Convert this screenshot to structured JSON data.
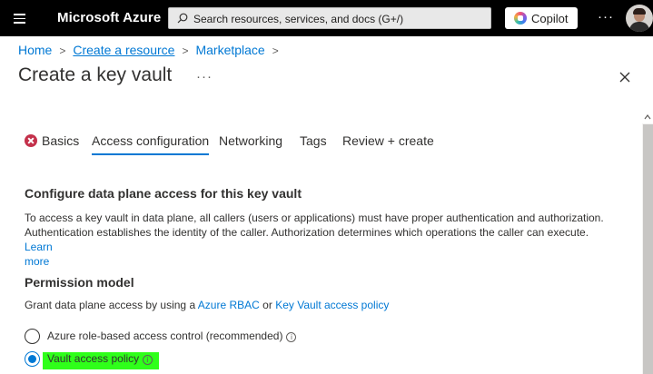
{
  "topbar": {
    "brand": "Microsoft Azure",
    "search_placeholder": "Search resources, services, and docs (G+/)",
    "copilot_label": "Copilot",
    "more": "···",
    "accent": "#000000"
  },
  "breadcrumb": {
    "items": [
      "Home",
      "Create a resource",
      "Marketplace"
    ],
    "separator": ">"
  },
  "page": {
    "title": "Create a key vault",
    "ellipsis": "···",
    "close_icon": "close-icon"
  },
  "tabs": [
    {
      "label": "Basics",
      "state": "error"
    },
    {
      "label": "Access configuration",
      "state": "active"
    },
    {
      "label": "Networking",
      "state": "normal"
    },
    {
      "label": "Tags",
      "state": "normal"
    },
    {
      "label": "Review + create",
      "state": "normal"
    }
  ],
  "section1": {
    "heading": "Configure data plane access for this key vault",
    "text_line1": "To access a key vault in data plane, all callers (users or applications) must have proper authentication and authorization.",
    "text_line2": "Authentication establishes the identity of the caller. Authorization determines which operations the caller can execute.",
    "learn": "Learn",
    "more": "more"
  },
  "section2": {
    "heading": "Permission model",
    "text_prefix": "Grant data plane access by using a",
    "link_rbac": "Azure RBAC",
    "text_or": "or",
    "link_policy": "Key Vault access policy",
    "options": [
      {
        "label": "Azure role-based access control (recommended)",
        "checked": false
      },
      {
        "label": "Vault access policy",
        "checked": true
      }
    ],
    "info_glyph": "i"
  },
  "colors": {
    "link": "#0078d4",
    "error": "#c4314b",
    "highlight": "#2fff1a"
  }
}
